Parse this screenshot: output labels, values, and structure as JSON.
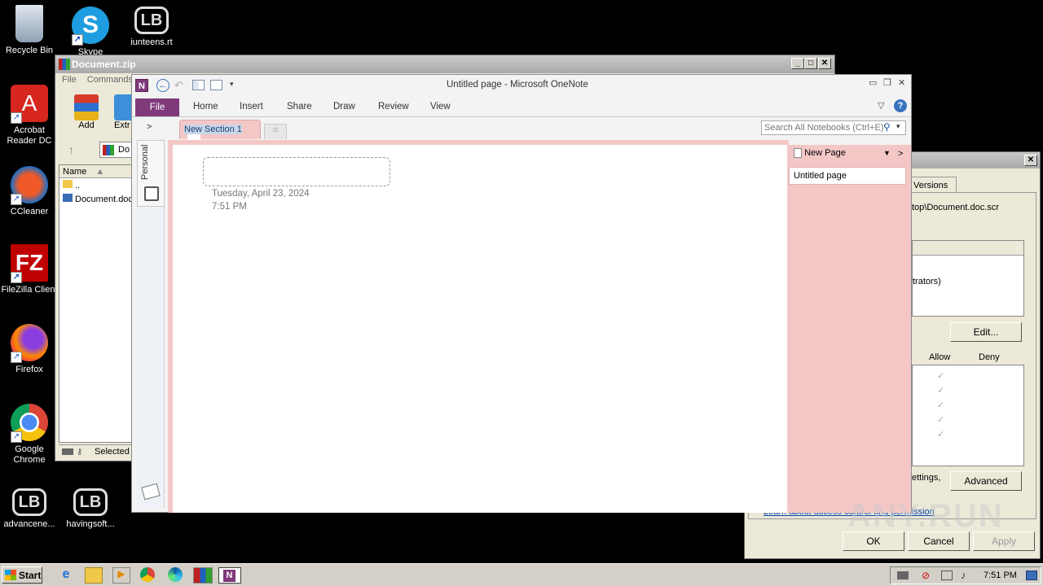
{
  "desktop": {
    "icons": [
      {
        "label": "Recycle Bin"
      },
      {
        "label": "Skype"
      },
      {
        "label": "iunteens.rt"
      },
      {
        "label": "Acrobat Reader DC"
      },
      {
        "label": "CCleaner"
      },
      {
        "label": "FileZilla Client"
      },
      {
        "label": "Firefox"
      },
      {
        "label": "Google Chrome"
      },
      {
        "label": "advancene..."
      },
      {
        "label": "havingsoft..."
      }
    ]
  },
  "winrar": {
    "title": "Document.zip",
    "menu": [
      "File",
      "Commands"
    ],
    "toolbar": {
      "add": "Add",
      "extract": "Extr"
    },
    "path": "Do",
    "column_name": "Name",
    "rows": [
      "..",
      "Document.doc"
    ],
    "status": "Selected"
  },
  "props": {
    "tab_versions": "Versions",
    "path_text": "top\\Document.doc.scr",
    "group_text": "trators)",
    "edit_label": "Edit...",
    "allow_label": "Allow",
    "deny_label": "Deny",
    "settings_text": "ettings,",
    "advanced_label": "Advanced",
    "link_text": "Learn about access control and permissions",
    "ok_label": "OK",
    "cancel_label": "Cancel",
    "apply_label": "Apply"
  },
  "onenote": {
    "title": "Untitled page  -  Microsoft OneNote",
    "ribbon_tabs": [
      "File",
      "Home",
      "Insert",
      "Share",
      "Draw",
      "Review",
      "View"
    ],
    "section_tab": "New Section 1",
    "search_placeholder": "Search All Notebooks (Ctrl+E)",
    "notebook_label": "Personal",
    "page_date": "Tuesday, April 23, 2024",
    "page_time": "7:51 PM",
    "new_page_label": "New Page",
    "pages": [
      "Untitled page"
    ]
  },
  "taskbar": {
    "start_label": "Start",
    "clock": "7:51 PM"
  },
  "watermark": "ANY.RUN",
  "colors": {
    "onenote_purple": "#80397b",
    "section_pink": "#f4c7c7",
    "desktop_bg": "#000000"
  }
}
